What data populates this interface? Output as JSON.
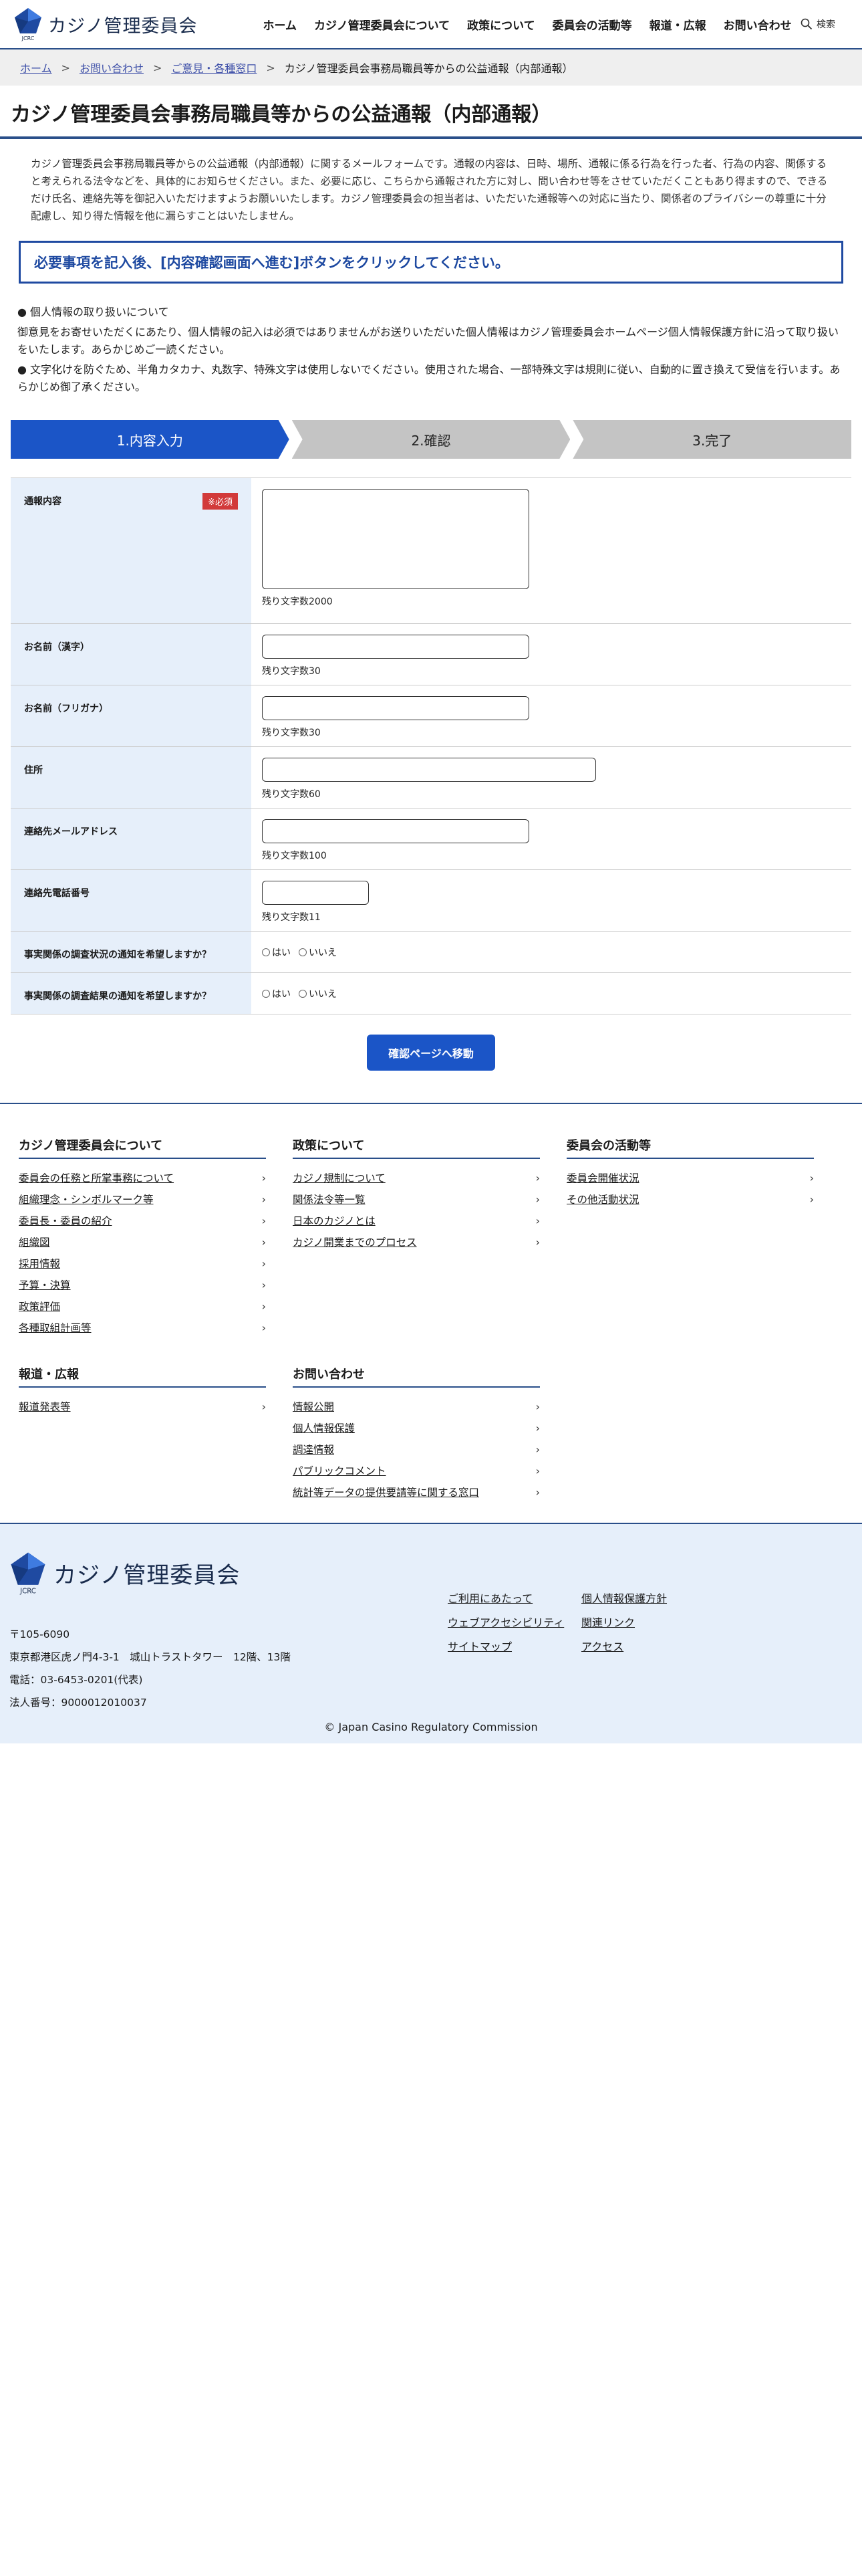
{
  "header": {
    "logo_text": "カジノ管理委員会",
    "logo_sub": "JCRC",
    "nav": [
      "ホーム",
      "カジノ管理委員会について",
      "政策について",
      "委員会の活動等",
      "報道・広報",
      "お問い合わせ"
    ],
    "search_label": "検索"
  },
  "breadcrumb": {
    "items": [
      "ホーム",
      "お問い合わせ",
      "ご意見・各種窓口"
    ],
    "current": "カジノ管理委員会事務局職員等からの公益通報（内部通報）",
    "sep": ">"
  },
  "page_title": "カジノ管理委員会事務局職員等からの公益通報（内部通報）",
  "intro": "カジノ管理委員会事務局職員等からの公益通報（内部通報）に関するメールフォームです。通報の内容は、日時、場所、通報に係る行為を行った者、行為の内容、関係すると考えられる法令などを、具体的にお知らせください。また、必要に応じ、こちらから通報された方に対し、問い合わせ等をさせていただくこともあり得ますので、できるだけ氏名、連絡先等を御記入いただけますようお願いいたします。カジノ管理委員会の担当者は、いただいた通報等への対応に当たり、関係者のプライバシーの尊重に十分配慮し、知り得た情報を他に漏らすことはいたしません。",
  "notice": "必要事項を記入後、[内容確認画面へ進む]ボタンをクリックしてください。",
  "notes": {
    "privacy_heading": "● 個人情報の取り扱いについて",
    "privacy_body": "御意見をお寄せいただくにあたり、個人情報の記入は必須ではありませんがお送りいただいた個人情報はカジノ管理委員会ホームページ個人情報保護方針に沿って取り扱いをいたします。あらかじめご一読ください。",
    "charset": "● 文字化けを防ぐため、半角カタカナ、丸数字、特殊文字は使用しないでください。使用された場合、一部特殊文字は規則に従い、自動的に置き換えて受信を行います。あらかじめ御了承ください。"
  },
  "steps": [
    "1.内容入力",
    "2.確認",
    "3.完了"
  ],
  "form": {
    "required_label": "※必須",
    "rows": [
      {
        "label": "通報内容",
        "count": "残り文字数2000"
      },
      {
        "label": "お名前（漢字）",
        "count": "残り文字数30"
      },
      {
        "label": "お名前（フリガナ）",
        "count": "残り文字数30"
      },
      {
        "label": "住所",
        "count": "残り文字数60"
      },
      {
        "label": "連絡先メールアドレス",
        "count": "残り文字数100"
      },
      {
        "label": "連絡先電話番号",
        "count": "残り文字数11"
      },
      {
        "label": "事実関係の調査状況の通知を希望しますか？"
      },
      {
        "label": "事実関係の調査結果の通知を希望しますか？"
      }
    ],
    "yes": "はい",
    "no": "いいえ",
    "submit": "確認ページへ移動"
  },
  "footer_links": {
    "col1": {
      "title": "カジノ管理委員会について",
      "items": [
        "委員会の任務と所掌事務について",
        "組織理念・シンボルマーク等",
        "委員長・委員の紹介",
        "組織図",
        "採用情報",
        "予算・決算",
        "政策評価",
        "各種取組計画等"
      ]
    },
    "col2": {
      "title": "政策について",
      "items": [
        "カジノ規制について",
        "関係法令等一覧",
        "日本のカジノとは",
        "カジノ開業までのプロセス"
      ]
    },
    "col3": {
      "title": "委員会の活動等",
      "items": [
        "委員会開催状況",
        "その他活動状況"
      ]
    },
    "col4": {
      "title": "報道・広報",
      "items": [
        "報道発表等"
      ]
    },
    "col5": {
      "title": "お問い合わせ",
      "items": [
        "情報公開",
        "個人情報保護",
        "調達情報",
        "パブリックコメント",
        "統計等データの提供要請等に関する窓口"
      ]
    }
  },
  "bottom_footer": {
    "logo_text": "カジノ管理委員会",
    "logo_sub": "JCRC",
    "postal": "〒105-6090",
    "address": "東京都港区虎ノ門4-3-1　城山トラストタワー　12階、13階",
    "tel": "電話：03-6453-0201(代表)",
    "corp_no": "法人番号：9000012010037",
    "links": [
      "ご利用にあたって",
      "個人情報保護方針",
      "ウェブアクセシビリティ",
      "関連リンク",
      "サイトマップ",
      "アクセス"
    ],
    "copyright": "© Japan Casino Regulatory Commission"
  },
  "colors": {
    "accent": "#1b55c7",
    "brand_navy": "#2a4f8a",
    "required": "#d23a3a",
    "label_bg": "#e6effa"
  },
  "icons": {
    "search": "search-icon",
    "chevron": "chevron-right-icon",
    "logo": "pentagon-logo-icon"
  }
}
